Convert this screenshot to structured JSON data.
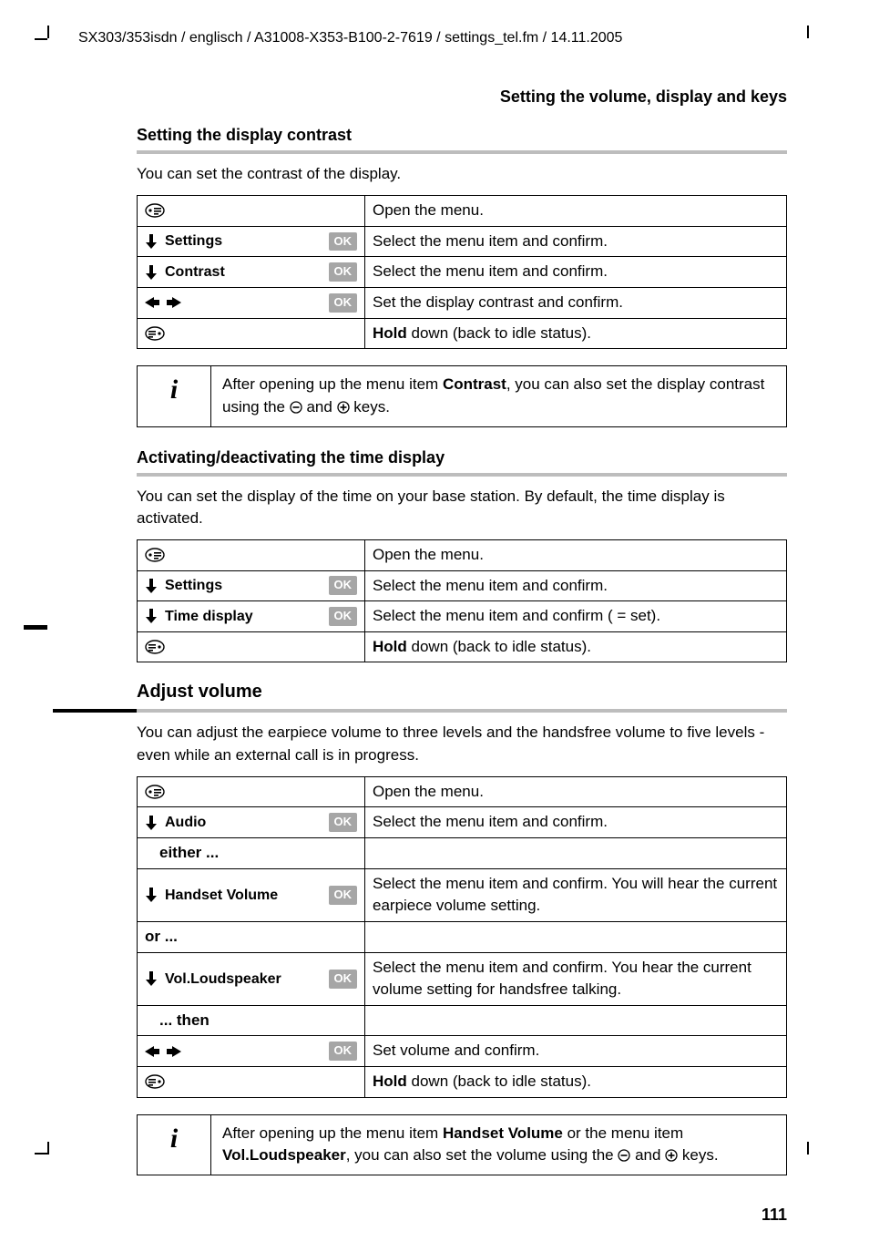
{
  "header": "SX303/353isdn / englisch / A31008-X353-B100-2-7619 / settings_tel.fm / 14.11.2005",
  "running_head": "Setting the volume, display and keys",
  "page_number": "111",
  "sec1": {
    "title": "Setting the display contrast",
    "intro": "You can set the contrast of the display.",
    "rows": {
      "r0d": "Open the menu.",
      "r1l": "Settings",
      "r1d": "Select the menu item and confirm.",
      "r2l": "Contrast",
      "r2d": "Select the menu item and confirm.",
      "r3d": "Set the display contrast and confirm.",
      "r4d_rest": " down (back to idle status)."
    },
    "info_pre": "After opening up the menu item ",
    "info_bold": "Contrast",
    "info_post1": ", you can also set the display contrast using the ",
    "info_post2": " and ",
    "info_post3": " keys."
  },
  "sec2": {
    "title": "Activating/deactivating the time display",
    "intro": "You can set the display of the time on your base station. By default, the time display is activated.",
    "rows": {
      "r0d": "Open the menu.",
      "r1l": "Settings",
      "r1d": "Select the menu item and confirm.",
      "r2l": "Time display",
      "r2d": "Select the menu item and confirm (     = set).",
      "r3d_rest": " down (back to idle status)."
    }
  },
  "sec3": {
    "title": "Adjust volume",
    "intro": "You can adjust the earpiece volume to three levels and the handsfree volume to five levels - even while an external call is in progress.",
    "rows": {
      "r0d": "Open the menu.",
      "r1l": "Audio",
      "r1d": "Select the menu item and confirm.",
      "either": "either ...",
      "r2l": "Handset Volume",
      "r2d": "Select the menu item and confirm. You will hear the current earpiece volume setting.",
      "or": "or ...",
      "r3l": "Vol.Loudspeaker",
      "r3d": "Select the menu item and confirm. You hear the current volume setting for handsfree talking.",
      "then": "... then",
      "r4d": "Set volume and confirm.",
      "r5d_rest": " down (back to idle status)."
    },
    "info_pre": "After opening up the menu item ",
    "info_b1": "Handset Volume",
    "info_mid": " or the menu item ",
    "info_b2": "Vol.Loudspeaker",
    "info_post1": ", you can also set the volume using the ",
    "info_post2": " and ",
    "info_post3": " keys."
  },
  "labels": {
    "ok": "OK",
    "hold": "Hold",
    "info_i": "i",
    "checkmark": "‰"
  }
}
